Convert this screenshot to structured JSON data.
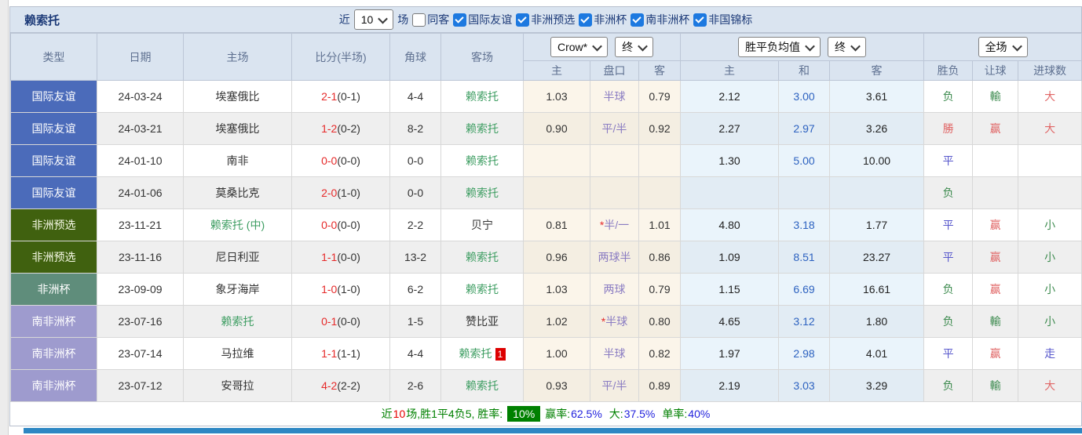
{
  "title": "赖索托",
  "filter": {
    "near_label": "近",
    "near_value": "10",
    "games_label": "场",
    "same_away_label": "同客",
    "leagues": [
      "国际友谊",
      "非洲预选",
      "非洲杯",
      "南非洲杯",
      "非国锦标"
    ]
  },
  "dropdowns": {
    "bookmaker": "Crow*",
    "handicap_final": "终",
    "avg_odds": "胜平负均值",
    "europe_final": "终",
    "scope": "全场"
  },
  "columns": {
    "main": [
      "类型",
      "日期",
      "主场",
      "比分(半场)",
      "角球",
      "客场"
    ],
    "sub": [
      "主",
      "盘口",
      "客",
      "主",
      "和",
      "客",
      "胜负",
      "让球",
      "进球数"
    ]
  },
  "table": {
    "rows": [
      {
        "type": "国际友谊",
        "type_color": "blue",
        "date": "24-03-24",
        "home": "埃塞俄比",
        "home_green": false,
        "score_ft": "2-1",
        "score_ht": "(0-1)",
        "corner": "4-4",
        "away": "赖索托",
        "away_green": true,
        "away_badge": "",
        "h_home": "1.03",
        "handicap_star": false,
        "handicap": "半球",
        "h_away": "0.79",
        "e_home": "2.12",
        "e_draw": "3.00",
        "e_away": "3.61",
        "result": "负",
        "result_color": "g",
        "handicap_result": "輸",
        "handicap_result_color": "g",
        "goals": "大",
        "goals_color": "r"
      },
      {
        "type": "国际友谊",
        "type_color": "blue",
        "date": "24-03-21",
        "home": "埃塞俄比",
        "home_green": false,
        "score_ft": "1-2",
        "score_ht": "(0-2)",
        "corner": "8-2",
        "away": "赖索托",
        "away_green": true,
        "away_badge": "",
        "h_home": "0.90",
        "handicap_star": false,
        "handicap": "平/半",
        "h_away": "0.92",
        "e_home": "2.27",
        "e_draw": "2.97",
        "e_away": "3.26",
        "result": "勝",
        "result_color": "r",
        "handicap_result": "赢",
        "handicap_result_color": "r",
        "goals": "大",
        "goals_color": "r"
      },
      {
        "type": "国际友谊",
        "type_color": "blue",
        "date": "24-01-10",
        "home": "南非",
        "home_green": false,
        "score_ft": "0-0",
        "score_ht": "(0-0)",
        "corner": "0-0",
        "away": "赖索托",
        "away_green": true,
        "away_badge": "",
        "h_home": "",
        "handicap_star": false,
        "handicap": "",
        "h_away": "",
        "e_home": "1.30",
        "e_draw": "5.00",
        "e_away": "10.00",
        "result": "平",
        "result_color": "b",
        "handicap_result": "",
        "handicap_result_color": "",
        "goals": "",
        "goals_color": ""
      },
      {
        "type": "国际友谊",
        "type_color": "blue",
        "date": "24-01-06",
        "home": "莫桑比克",
        "home_green": false,
        "score_ft": "2-0",
        "score_ht": "(1-0)",
        "corner": "0-0",
        "away": "赖索托",
        "away_green": true,
        "away_badge": "",
        "h_home": "",
        "handicap_star": false,
        "handicap": "",
        "h_away": "",
        "e_home": "",
        "e_draw": "",
        "e_away": "",
        "result": "负",
        "result_color": "g",
        "handicap_result": "",
        "handicap_result_color": "",
        "goals": "",
        "goals_color": ""
      },
      {
        "type": "非洲预选",
        "type_color": "dgreen",
        "date": "23-11-21",
        "home": "赖索托 (中)",
        "home_green": true,
        "score_ft": "0-0",
        "score_ht": "(0-0)",
        "corner": "2-2",
        "away": "贝宁",
        "away_green": false,
        "away_badge": "",
        "h_home": "0.81",
        "handicap_star": true,
        "handicap": "半/一",
        "h_away": "1.01",
        "e_home": "4.80",
        "e_draw": "3.18",
        "e_away": "1.77",
        "result": "平",
        "result_color": "b",
        "handicap_result": "赢",
        "handicap_result_color": "r",
        "goals": "小",
        "goals_color": "g"
      },
      {
        "type": "非洲预选",
        "type_color": "dgreen",
        "date": "23-11-16",
        "home": "尼日利亚",
        "home_green": false,
        "score_ft": "1-1",
        "score_ht": "(0-0)",
        "corner": "13-2",
        "away": "赖索托",
        "away_green": true,
        "away_badge": "",
        "h_home": "0.96",
        "handicap_star": false,
        "handicap": "两球半",
        "h_away": "0.86",
        "e_home": "1.09",
        "e_draw": "8.51",
        "e_away": "23.27",
        "result": "平",
        "result_color": "b",
        "handicap_result": "赢",
        "handicap_result_color": "r",
        "goals": "小",
        "goals_color": "g"
      },
      {
        "type": "非洲杯",
        "type_color": "teal",
        "date": "23-09-09",
        "home": "象牙海岸",
        "home_green": false,
        "score_ft": "1-0",
        "score_ht": "(1-0)",
        "corner": "6-2",
        "away": "赖索托",
        "away_green": true,
        "away_badge": "",
        "h_home": "1.03",
        "handicap_star": false,
        "handicap": "两球",
        "h_away": "0.79",
        "e_home": "1.15",
        "e_draw": "6.69",
        "e_away": "16.61",
        "result": "负",
        "result_color": "g",
        "handicap_result": "赢",
        "handicap_result_color": "r",
        "goals": "小",
        "goals_color": "g"
      },
      {
        "type": "南非洲杯",
        "type_color": "purple",
        "date": "23-07-16",
        "home": "赖索托",
        "home_green": true,
        "score_ft": "0-1",
        "score_ht": "(0-0)",
        "corner": "1-5",
        "away": "赞比亚",
        "away_green": false,
        "away_badge": "",
        "h_home": "1.02",
        "handicap_star": true,
        "handicap": "半球",
        "h_away": "0.80",
        "e_home": "4.65",
        "e_draw": "3.12",
        "e_away": "1.80",
        "result": "负",
        "result_color": "g",
        "handicap_result": "輸",
        "handicap_result_color": "g",
        "goals": "小",
        "goals_color": "g"
      },
      {
        "type": "南非洲杯",
        "type_color": "purple",
        "date": "23-07-14",
        "home": "马拉维",
        "home_green": false,
        "score_ft": "1-1",
        "score_ht": "(1-1)",
        "corner": "4-4",
        "away": "赖索托",
        "away_green": true,
        "away_badge": "1",
        "h_home": "1.00",
        "handicap_star": false,
        "handicap": "半球",
        "h_away": "0.82",
        "e_home": "1.97",
        "e_draw": "2.98",
        "e_away": "4.01",
        "result": "平",
        "result_color": "b",
        "handicap_result": "赢",
        "handicap_result_color": "r",
        "goals": "走",
        "goals_color": "b"
      },
      {
        "type": "南非洲杯",
        "type_color": "purple",
        "date": "23-07-12",
        "home": "安哥拉",
        "home_green": false,
        "score_ft": "4-2",
        "score_ht": "(2-2)",
        "corner": "2-6",
        "away": "赖索托",
        "away_green": true,
        "away_badge": "",
        "h_home": "0.93",
        "handicap_star": false,
        "handicap": "平/半",
        "h_away": "0.89",
        "e_home": "2.19",
        "e_draw": "3.03",
        "e_away": "3.29",
        "result": "负",
        "result_color": "g",
        "handicap_result": "輸",
        "handicap_result_color": "g",
        "goals": "大",
        "goals_color": "r"
      }
    ]
  },
  "summary": {
    "near_label": "近",
    "near_count": "10",
    "record_text": "场,胜1平4负5, 胜率:",
    "win_rate": "10%",
    "win_odds_label": "赢率:",
    "win_odds_value": "62.5%",
    "big_label": "大:",
    "big_value": "37.5%",
    "single_label": "单率:",
    "single_value": "40%"
  },
  "colors": {
    "badge_friendly": "#4b6bba",
    "badge_afcon_qualifier": "#40610f",
    "badge_afcon": "#5f8d7b",
    "badge_cosafa": "#9e9bce",
    "header_bg": "#dae4f0",
    "team_highlight_green": "#3f9e63",
    "score_red": "#e62a2a",
    "handicap_purple": "#8a7cc2",
    "draw_odds_blue": "#2d62c0",
    "result_green": "#3d8b4f",
    "result_red": "#e06666",
    "result_blue": "#5757cc",
    "win_rate_badge_bg": "#008000",
    "summary_value_blue": "#2222dd",
    "bottom_bar_blue": "#2d87c3",
    "checkbox_blue": "#1d79e0"
  }
}
